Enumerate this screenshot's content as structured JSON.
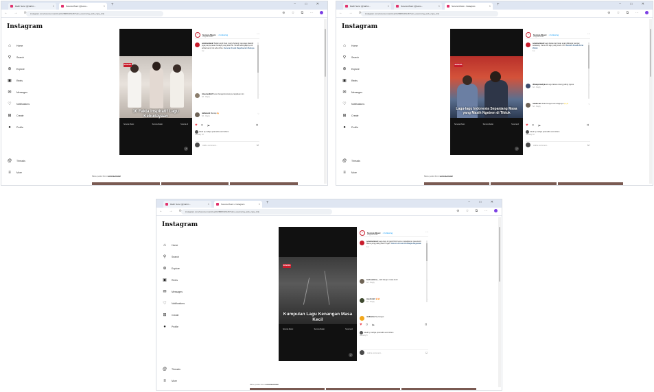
{
  "browser": {
    "tabs": [
      "Ratih Nurul (@ratihn...",
      "Sonora Music (@sono...",
      "Sonora Music • Instagram"
    ],
    "url": "instagram.com/sonora.music/reel/C2BRfXxPAv5/?utm_source=ig_web_copy_link",
    "window_controls": "– □ ✕"
  },
  "instagram": {
    "logo": "Instagram",
    "nav": [
      "Home",
      "Search",
      "Explore",
      "Reels",
      "Messages",
      "Notifications",
      "Create",
      "Profile"
    ],
    "nav_bottom": [
      "Threads",
      "More"
    ],
    "account": "Sonora.Music",
    "follow": "• Following",
    "audio": "Original audio",
    "more_from": "More posts from",
    "more_from_account": "sonora.music",
    "add_comment": "Add a comment...",
    "icon_colors": {
      "liked": "#ed4956",
      "brand": "#c81c2c",
      "link": "#0095f6"
    }
  },
  "screens": [
    {
      "reel_caption": "10 Fakta Inspiratif Lagu Kebudayaan",
      "reel_badge": "SONORA",
      "chips": [
        "Sonora.Music",
        "Sonora Radio",
        "Sonora.Id"
      ],
      "comments": [
        {
          "user": "sonora.music",
          "text": "Selain asyik buat nyanyi bareng, lagu-lagu daerah juga punya pesan budaya yang kuat lho. Simak selengkapnya di artikel kami, link ada di bio.",
          "hashtags": "#sonora #musik #laguDaerah #budaya",
          "meta": "1w"
        },
        {
          "user": "rina.musik12",
          "text": "Keren banget kontennya, lanjutkan min",
          "meta": "6d · Reply"
        },
        {
          "user": "ratihnurul",
          "text": "Mantap 🔥",
          "meta": "5d · Reply"
        }
      ],
      "likes": "Liked by raditya.pramudito and others",
      "date": "January 12"
    },
    {
      "reel_caption": "Lagu-lagu Indonesia Sepanjang Masa yang Masih Ngetren di Tiktok",
      "reel_badge": "SONORA",
      "chips": [
        "Sonora.Music",
        "Sonora Radio",
        "Sonora.Id"
      ],
      "comments": [
        {
          "user": "sonora.music",
          "text": "Lagu lawas tapi tetap enak didengar sampai sekarang. Kamu tim lagu yang mana nih?",
          "hashtags": "#sonora #musik #viral #tiktok",
          "meta": "1w"
        },
        {
          "user": "dimasprasetya.co",
          "text": "Lagu lawas emang paling ngena",
          "meta": "6d · Reply"
        },
        {
          "user": "nanda.sari",
          "text": "Suka banget sama lagunya ✨✨",
          "meta": "5d · Reply"
        }
      ],
      "likes": "Liked by raditya.pramudito and others",
      "date": "January 10"
    },
    {
      "reel_caption": "Kumpulan Lagu Kenangan Masa Kecil",
      "reel_badge": "SONORA",
      "chips": [
        "Sonora.Music",
        "Sonora Radio",
        "Sonora.Id"
      ],
      "comments": [
        {
          "user": "sonora.music",
          "text": "Lagu-lagu ini pasti bikin kamu nostalgia ke masa kecil. Mana yang paling kamu ingat?",
          "hashtags": "#sonora #musik #nostalgia #laguanak",
          "meta": "1w"
        },
        {
          "user": "budi.santoso_",
          "text": "Jadi kangen masa kecil",
          "meta": "6d · Reply"
        },
        {
          "user": "ayu.lestari",
          "text": "🔥🔥",
          "meta": "5d · Reply"
        },
        {
          "user": "mellavina",
          "text": "Top banget",
          "meta": "4d · Reply"
        }
      ],
      "likes": "Liked by raditya.pramudito and others",
      "date": "January 8"
    }
  ]
}
